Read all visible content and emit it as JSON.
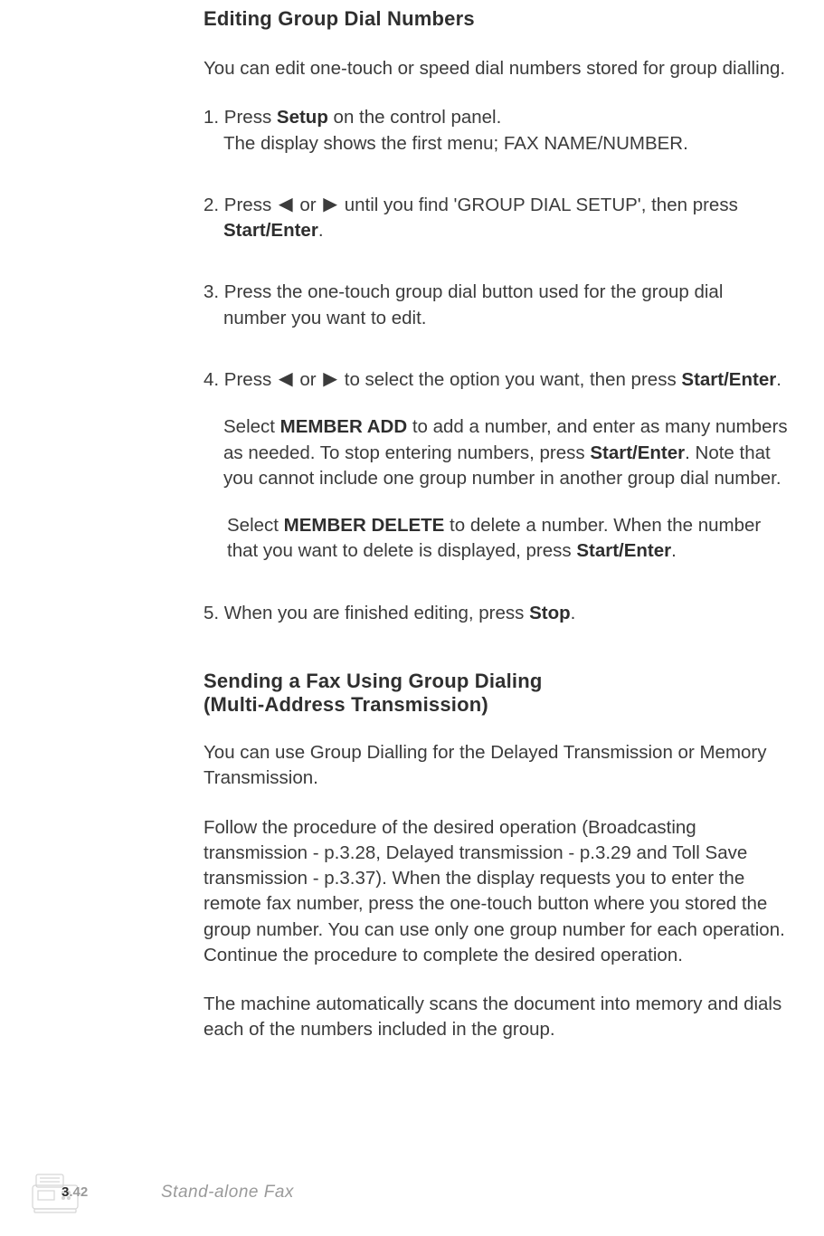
{
  "sections": {
    "edit": {
      "title": "Editing Group Dial Numbers",
      "intro": "You can edit one-touch or speed dial numbers stored for group dialling.",
      "steps": {
        "s1_a": "1. Press ",
        "s1_b": "Setup",
        "s1_c": " on the control panel.",
        "s1_cont": "The display shows the first menu; FAX NAME/NUMBER.",
        "s2_a": "2. Press ",
        "s2_b": " or ",
        "s2_c": " until you find 'GROUP DIAL SETUP', then press",
        "s2_cont_bold": "Start/Enter",
        "s2_cont_tail": ".",
        "s3_a": "3. Press the one-touch group dial button used for the group dial",
        "s3_cont": "number you want to edit.",
        "s4_a": "4. Press ",
        "s4_b": " or ",
        "s4_c": " to select the option you want, then press ",
        "s4_bold": "Start/Enter",
        "s4_tail": ".",
        "s4_p1_a": "Select ",
        "s4_p1_bold": "MEMBER ADD",
        "s4_p1_b": " to add a number, and enter as many numbers as needed. To stop entering numbers, press ",
        "s4_p1_bold2": "Start/Enter",
        "s4_p1_c": ". Note that you cannot include one group number in another group dial number.",
        "s4_p2_a": "Select ",
        "s4_p2_bold": "MEMBER DELETE",
        "s4_p2_b": " to delete a number. When the number that you want to delete is displayed, press ",
        "s4_p2_bold2": "Start/Enter",
        "s4_p2_c": ".",
        "s5_a": "5. When you are finished editing, press ",
        "s5_bold": "Stop",
        "s5_tail": "."
      }
    },
    "send": {
      "title_l1": "Sending a Fax Using Group Dialing",
      "title_l2": "(Multi-Address Transmission)",
      "p1": "You can use Group Dialling for the Delayed Transmission or Memory Transmission.",
      "p2": "Follow the procedure of the desired operation (Broadcasting transmission - p.3.28, Delayed transmission - p.3.29 and Toll Save transmission - p.3.37). When the display requests you to enter the remote fax number, press the one-touch button where you stored the group number. You can use only one group number for each operation. Continue the procedure to complete the desired operation.",
      "p3": "The machine automatically scans the document into memory and dials each of the numbers included in the group."
    }
  },
  "footer": {
    "page_chapter": "3",
    "page_num": ".42",
    "label": "Stand-alone Fax"
  },
  "icons": {
    "left_arrow": "◀",
    "right_arrow": "▶"
  }
}
